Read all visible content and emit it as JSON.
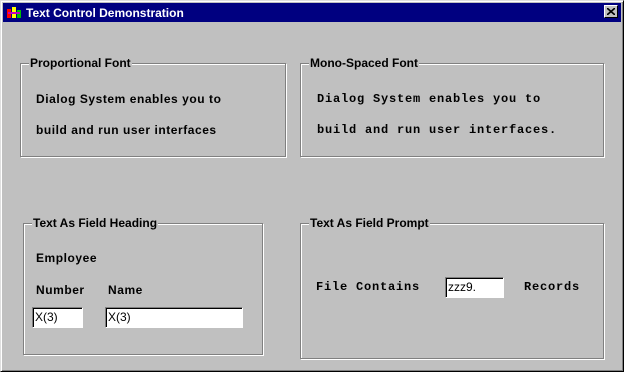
{
  "window": {
    "title": "Text Control Demonstration",
    "icon": "app-logo-icon",
    "close_icon": "close-icon"
  },
  "proportional": {
    "heading": "Proportional Font",
    "line1": "Dialog System enables you to",
    "line2": "build and run user interfaces"
  },
  "monospaced": {
    "heading": "Mono-Spaced Font",
    "line1": "Dialog System enables you to",
    "line2": "build and run user interfaces."
  },
  "field_heading": {
    "heading": "Text As Field Heading",
    "employee_label": "Employee",
    "number_label": "Number",
    "name_label": "Name",
    "number_value": "X(3)",
    "name_value": "X(3)"
  },
  "field_prompt": {
    "heading": "Text As Field Prompt",
    "prompt_label": "File Contains",
    "value": "zzz9.",
    "suffix_label": "Records"
  },
  "colors": {
    "titlebar": "#000080",
    "face": "#c0c0c0"
  }
}
